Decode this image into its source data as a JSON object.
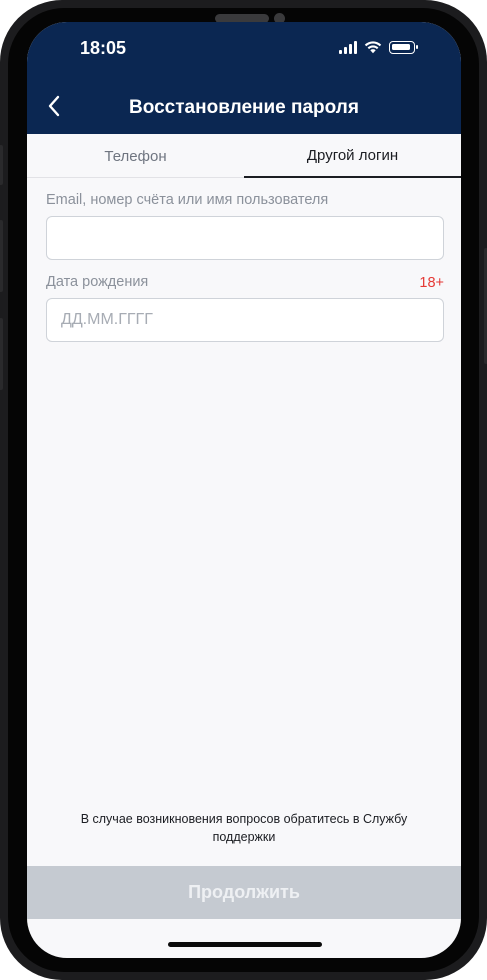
{
  "status_bar": {
    "time": "18:05",
    "icons": [
      "signal-icon",
      "wifi-icon",
      "battery-icon"
    ]
  },
  "header": {
    "title": "Восстановление пароля",
    "back_icon": "chevron-left-icon"
  },
  "tabs": [
    {
      "label": "Телефон",
      "active": false
    },
    {
      "label": "Другой логин",
      "active": true
    }
  ],
  "form": {
    "login_label": "Email, номер счёта или имя пользователя",
    "login_value": "",
    "birth_label": "Дата рождения",
    "age_badge": "18+",
    "birth_placeholder": "ДД.ММ.ГГГГ"
  },
  "support_text": "В случае возникновения вопросов обратитесь в Службу поддержки",
  "continue_label": "Продолжить",
  "colors": {
    "header_bg": "#0b2752",
    "accent_red": "#e53935",
    "disabled_button": "#c5cad1"
  }
}
